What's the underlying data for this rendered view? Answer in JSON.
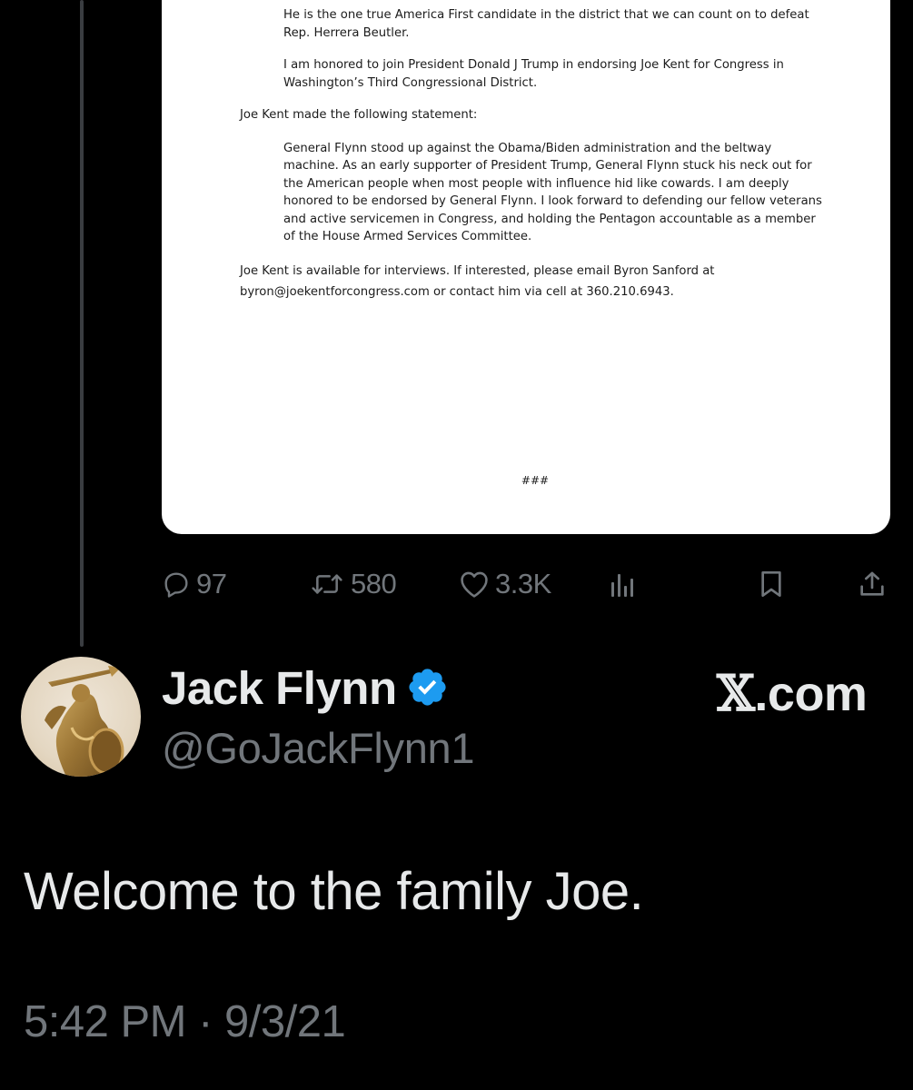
{
  "document": {
    "para1": "He is the one true America First candidate in the district that we can count on to defeat Rep. Herrera Beutler.",
    "para2": "I am honored to join President Donald J Trump in endorsing Joe Kent for Congress in Washington’s Third Congressional District.",
    "statement_intro": "Joe Kent made the following statement:",
    "statement": "General Flynn stood up against the Obama/Biden administration and the beltway machine. As an early supporter of President Trump, General Flynn stuck his neck out for the American people when most people with influence hid like cowards. I am deeply honored to be endorsed by General Flynn. I look forward to defending our fellow veterans and active servicemen in Congress, and holding the Pentagon accountable as a member of the House Armed Services Committee.",
    "contact": "Joe Kent is available for interviews. If interested, please email Byron Sanford at byron@joekentforcongress.com or contact him via cell at 360.210.6943.",
    "end_mark": "###"
  },
  "actions": {
    "replies": "97",
    "reposts": "580",
    "likes": "3.3K"
  },
  "icons": {
    "reply": "reply-icon",
    "repost": "repost-icon",
    "like": "heart-icon",
    "views": "analytics-icon",
    "bookmark": "bookmark-icon",
    "share": "share-icon",
    "verified": "verified-badge-icon",
    "brand": "x-logo"
  },
  "author": {
    "display_name": "Jack Flynn",
    "handle": "@GoJackFlynn1"
  },
  "brand": {
    "x": "𝕏",
    "suffix": ".com"
  },
  "tweet": {
    "text": "Welcome to the family Joe.",
    "timestamp": "5:42 PM · 9/3/21"
  },
  "colors": {
    "background": "#000000",
    "primary_text": "#e7e9ea",
    "secondary_text": "#71767b",
    "verified_blue": "#1d9bf0",
    "thread_line": "#3a3d41"
  }
}
